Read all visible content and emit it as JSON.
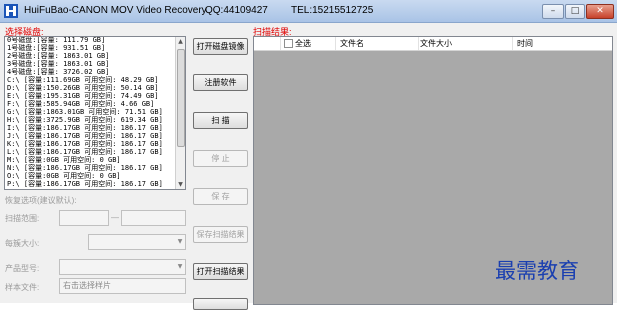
{
  "window": {
    "title": "HuiFuBao-CANON MOV Video Recovery",
    "qq": "QQ:44109427",
    "tel": "TEL:15215512725",
    "controls": {
      "minimize": "–",
      "maximize": "□",
      "close": "✕"
    }
  },
  "left": {
    "select_disk_label": "选择磁盘:",
    "disks": [
      "0号磁盘:[容量: 111.79 GB]",
      "1号磁盘:[容量: 931.51 GB]",
      "2号磁盘:[容量: 1863.01 GB]",
      "3号磁盘:[容量: 1863.01 GB]",
      "4号磁盘:[容量: 3726.02 GB]",
      "C:\\ [容量:111.69GB 可用空间: 48.29 GB]",
      "D:\\ [容量:150.26GB 可用空间: 50.14 GB]",
      "E:\\ [容量:195.31GB 可用空间: 74.49 GB]",
      "F:\\ [容量:585.94GB 可用空间: 4.66 GB]",
      "G:\\ [容量:1863.01GB 可用空间: 71.51 GB]",
      "H:\\ [容量:3725.9GB 可用空间: 619.34 GB]",
      "I:\\ [容量:186.17GB 可用空间: 186.17 GB]",
      "J:\\ [容量:186.17GB 可用空间: 186.17 GB]",
      "K:\\ [容量:186.17GB 可用空间: 186.17 GB]",
      "L:\\ [容量:186.17GB 可用空间: 186.17 GB]",
      "M:\\ [容量:0GB 可用空间: 0 GB]",
      "N:\\ [容量:186.17GB 可用空间: 186.17 GB]",
      "O:\\ [容量:0GB 可用空间: 0 GB]",
      "P:\\ [容量:186.17GB 可用空间: 186.17 GB]"
    ],
    "restore_options_label": "恢复选项(建议默认):",
    "scan_range_label": "扫描范围:",
    "range_separator": "—",
    "cluster_size_label": "每簇大小:",
    "product_model_label": "产品型号:",
    "sample_file_label": "样本文件:",
    "sample_file_value": "右击选择样片"
  },
  "buttons": {
    "open_image": "打开磁盘镜像",
    "register": "注册软件",
    "scan": "扫  描",
    "stop": "停  止",
    "save": "保  存",
    "save_scan_result": "保存扫描结果",
    "open_scan_result": "打开扫描结果"
  },
  "results": {
    "label": "扫描结果:",
    "columns": {
      "select_all": "全选",
      "file_name": "文件名",
      "file_size": "文件大小",
      "time": "时间"
    }
  },
  "watermark": "最需教育",
  "colors": {
    "accent_red": "#e00000",
    "result_bg": "#a9a9a9",
    "watermark_blue": "#1a3fb0",
    "titlebar": "#b8cfea"
  }
}
